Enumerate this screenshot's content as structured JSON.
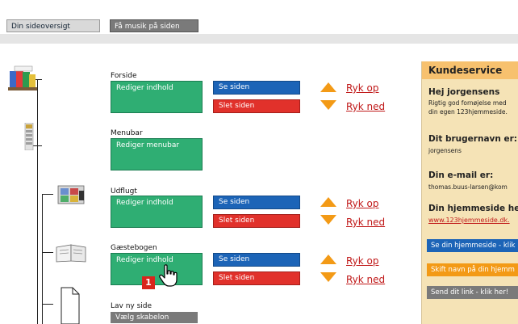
{
  "tabs": {
    "overview": "Din sideoversigt",
    "music": "Få musik på siden"
  },
  "pages": [
    {
      "title": "Forside",
      "edit": "Rediger indhold",
      "view": "Se siden",
      "delete": "Slet siden",
      "up": "Ryk op",
      "down": "Ryk ned"
    },
    {
      "title": "Menubar",
      "edit": "Rediger menubar"
    },
    {
      "title": "Udflugt",
      "edit": "Rediger indhold",
      "view": "Se siden",
      "delete": "Slet siden",
      "up": "Ryk op",
      "down": "Ryk ned"
    },
    {
      "title": "Gæstebogen",
      "edit": "Rediger indhold",
      "view": "Se siden",
      "delete": "Slet siden",
      "up": "Ryk op",
      "down": "Ryk ned"
    }
  ],
  "new_page": {
    "title": "Lav ny side",
    "template": "Vælg skabelon"
  },
  "badge": "1",
  "customer_service": {
    "title": "Kundeservice",
    "greeting": "Hej jorgensens",
    "greeting_line1": "Rigtig god fornøjelse med",
    "greeting_line2": "din egen 123hjemmeside.",
    "username_label": "Dit brugernavn er:",
    "username": "jorgensens",
    "email_label": "Din e-mail er:",
    "email": "thomas.buus-larsen@kom",
    "site_label": "Din hjemmeside hed",
    "site_url": "www.123hjemmeside.dk.",
    "btn_view": "Se din hjemmeside - klik",
    "btn_rename": "Skift navn på din hjemm",
    "btn_send": "Send dit link - klik her!"
  }
}
